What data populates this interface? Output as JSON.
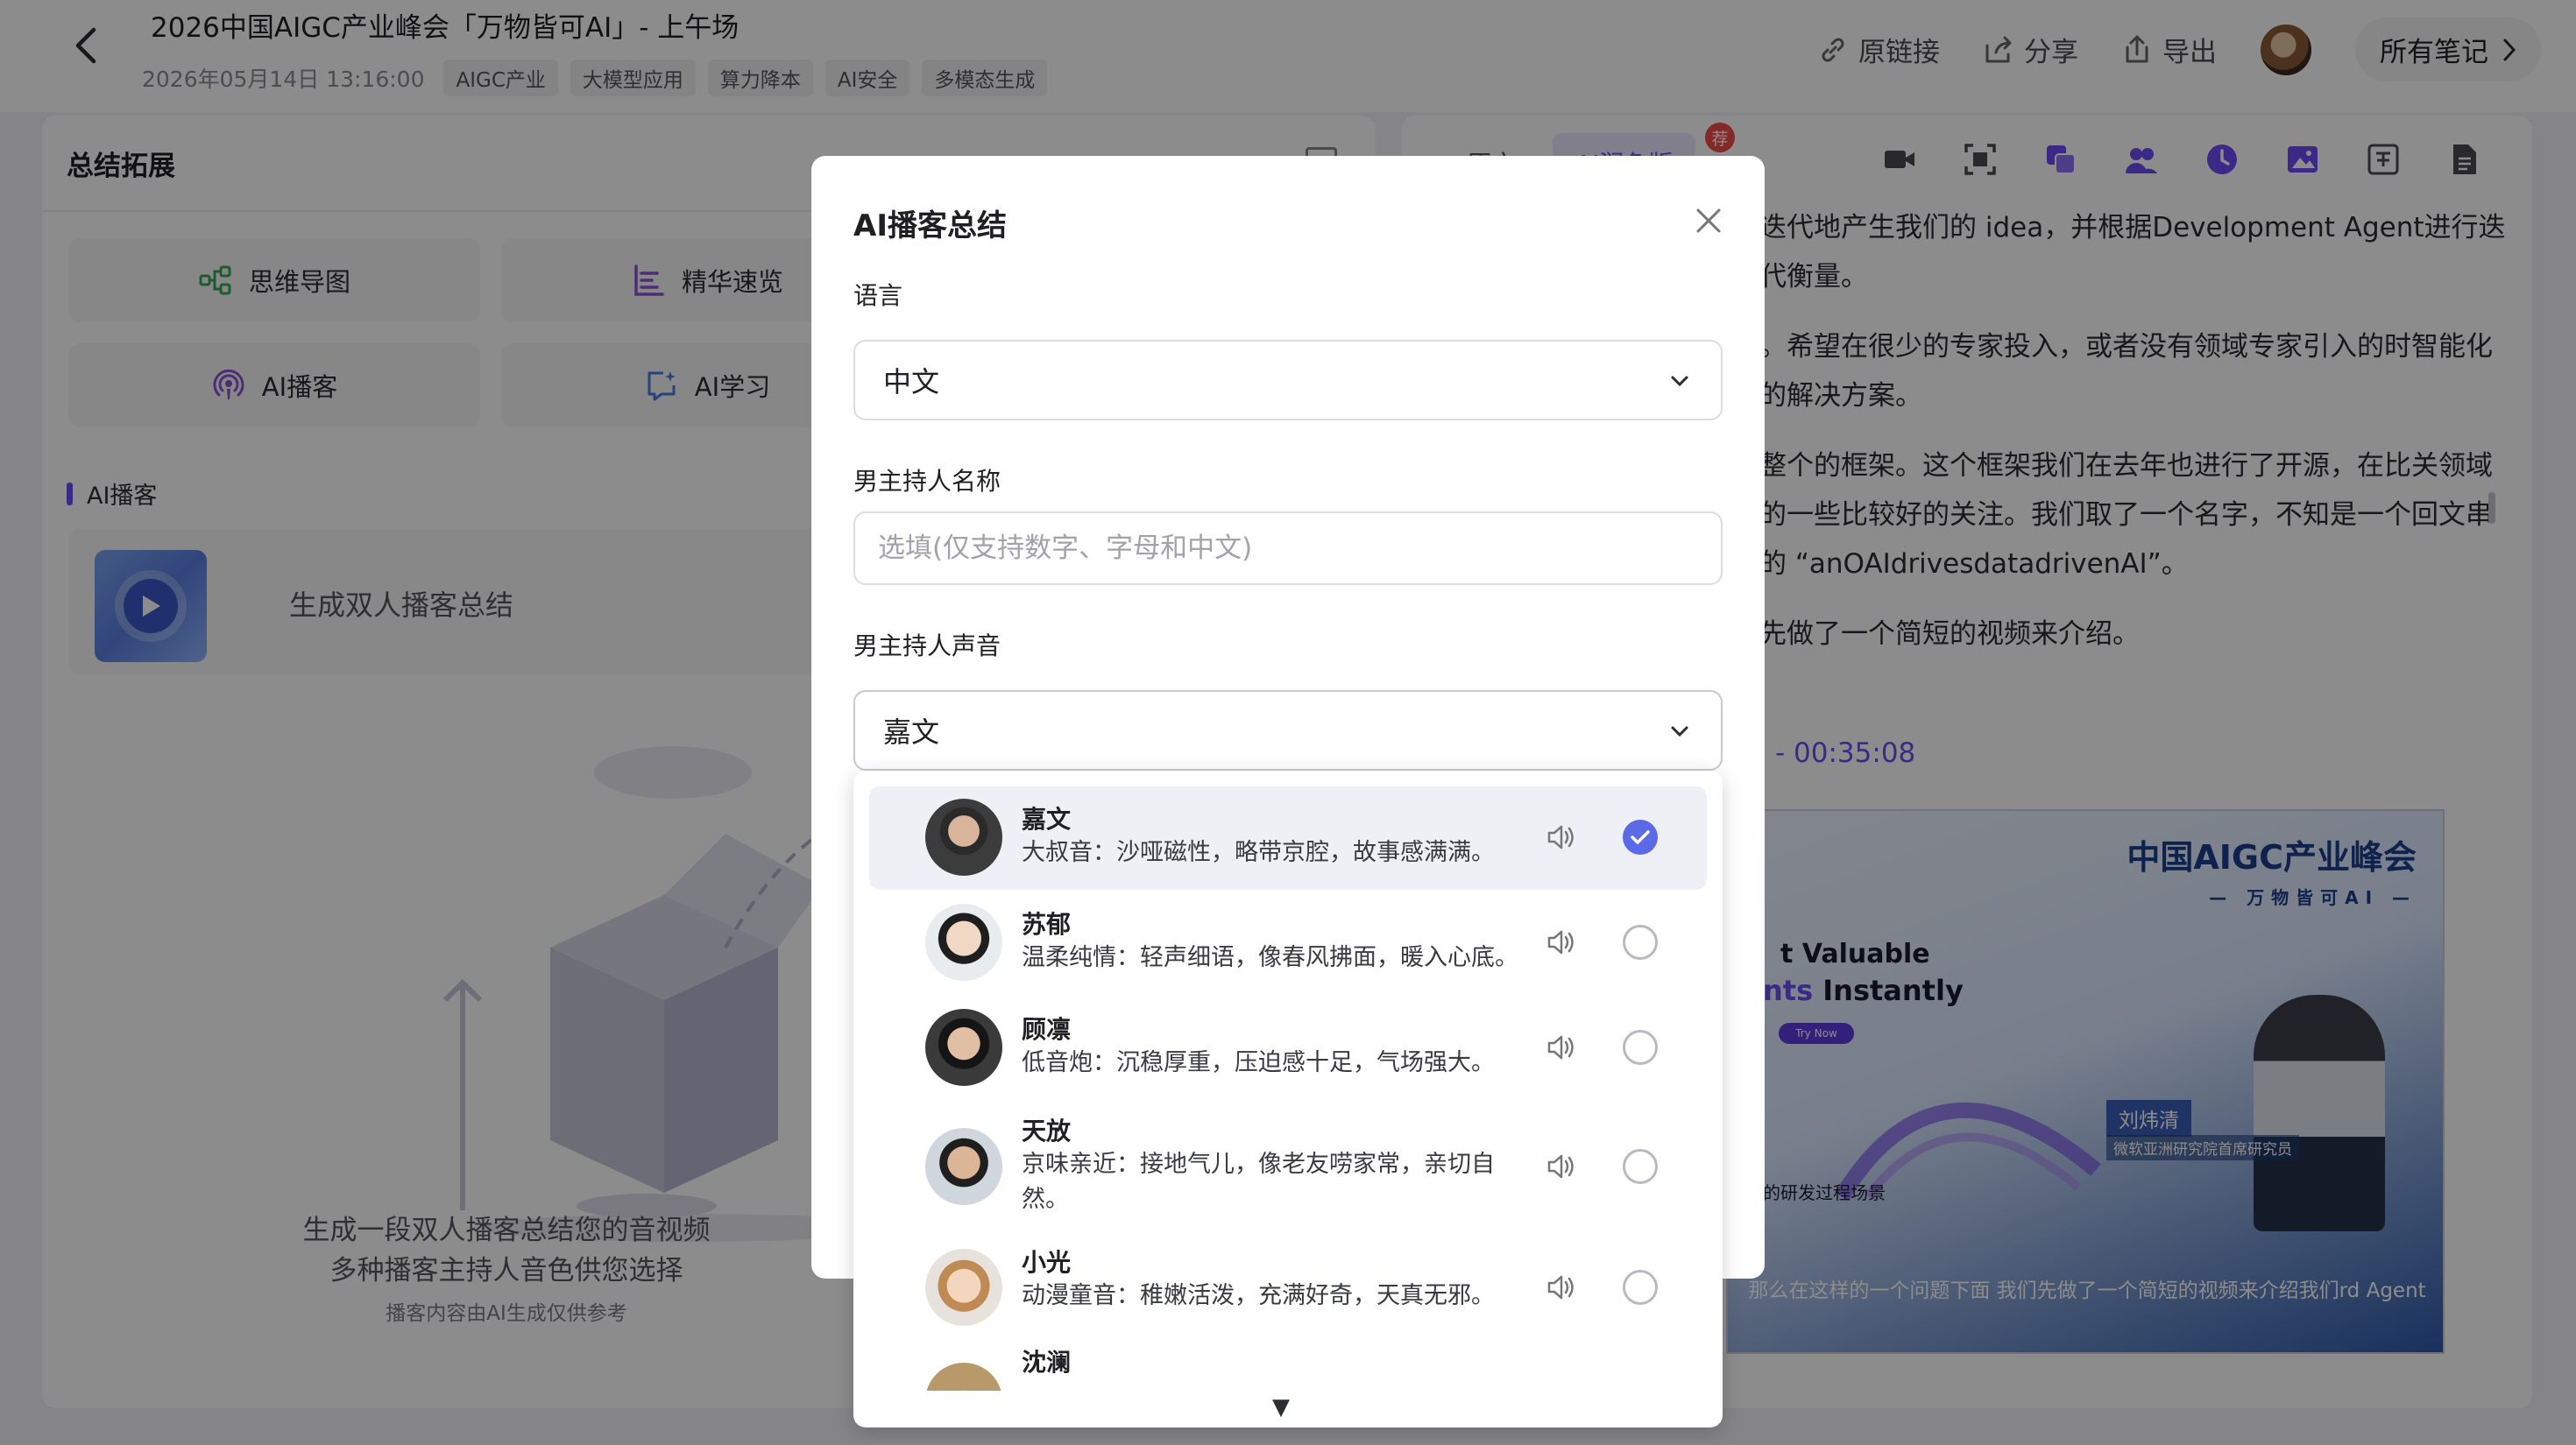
{
  "header": {
    "title": "2026中国AIGC产业峰会「万物皆可AI」- 上午场",
    "date": "2026年05月14日 13:16:00",
    "tags": [
      "AIGC产业",
      "大模型应用",
      "算力降本",
      "AI安全",
      "多模态生成"
    ],
    "actions": {
      "link": "原链接",
      "share": "分享",
      "export": "导出",
      "notes": "所有笔记"
    }
  },
  "left_panel": {
    "title": "总结拓展",
    "tools": [
      "思维导图",
      "精华速览",
      "AI播客",
      "AI学习"
    ],
    "section": "AI播客",
    "podcast_card": "生成双人播客总结",
    "empty_text_1": "生成一段双人播客总结您的音视频",
    "empty_text_2": "多种播客主持人音色供您选择",
    "empty_note": "播客内容由AI生成仅供参考"
  },
  "right_panel": {
    "tabs": [
      "原文",
      "AI润色版"
    ],
    "badge": "荐",
    "transcript": [
      "迭代地产生我们的 idea，并根据Development Agent进行迭代衡量。",
      "。希望在很少的专家投入，或者没有领域专家引入的时智能化的解决方案。",
      "整个的框架。这个框架我们在去年也进行了开源，在比关领域的一些比较好的关注。我们取了一个名字，不知是一个回文串的 “anOAIdrivesdatadrivenAI”。",
      "先做了一个简短的视频来介绍。"
    ],
    "time_range": "- 00:35:08",
    "video": {
      "brand": "中国AIGC产业峰会",
      "brand_sub": "— 万物皆可AI —",
      "slide_line1": "t Valuable",
      "slide_line2a": "nts",
      "slide_line2b": " Instantly",
      "slide_button": "Try Now",
      "speaker_name": "刘炜清",
      "speaker_role": "微软亚洲研究院首席研究员",
      "scene": "的研发过程场景",
      "caption": "那么在这样的一个问题下面 我们先做了一个简短的视频来介绍我们rd Agent"
    }
  },
  "modal": {
    "title": "AI播客总结",
    "language_label": "语言",
    "language_value": "中文",
    "male_name_label": "男主持人名称",
    "male_name_placeholder": "选填(仅支持数字、字母和中文)",
    "male_name_value": "",
    "male_voice_label": "男主持人声音",
    "male_voice_value": "嘉文",
    "voices": [
      {
        "name": "嘉文",
        "desc": "大叔音：沙哑磁性，略带京腔，故事感满满。",
        "selected": true
      },
      {
        "name": "苏郁",
        "desc": "温柔纯情：轻声细语，像春风拂面，暖入心底。",
        "selected": false
      },
      {
        "name": "顾凛",
        "desc": "低音炮：沉稳厚重，压迫感十足，气场强大。",
        "selected": false
      },
      {
        "name": "天放",
        "desc": "京味亲近：接地气儿，像老友唠家常，亲切自然。",
        "selected": false
      },
      {
        "name": "小光",
        "desc": "动漫童音：稚嫩活泼，充满好奇，天真无邪。",
        "selected": false
      },
      {
        "name": "沈澜",
        "desc": "",
        "selected": false
      }
    ],
    "scroll_arrow": "▼"
  },
  "colors": {
    "accent": "#6b4cf6",
    "radio_checked": "#5b6be8",
    "overlay": "rgba(0,0,0,0.45)"
  }
}
